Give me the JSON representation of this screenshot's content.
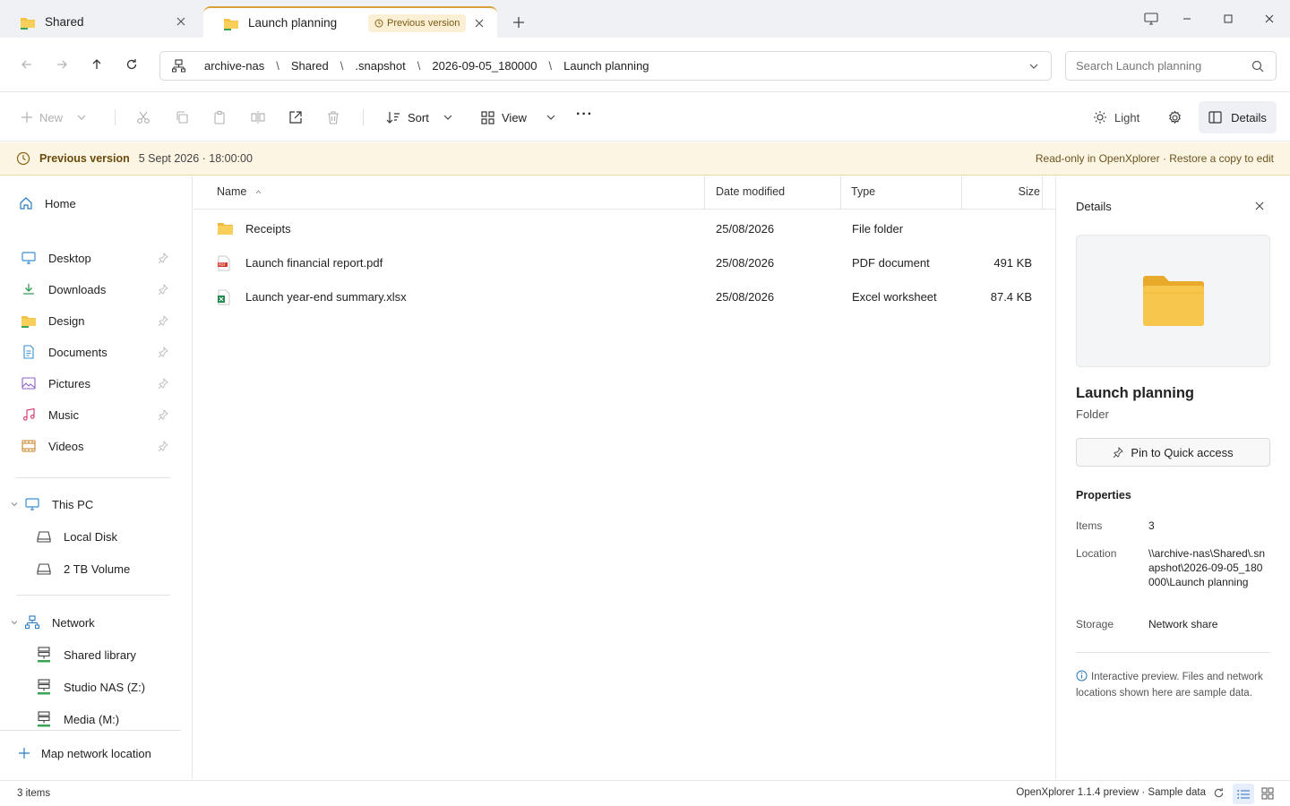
{
  "tabs": [
    {
      "label": "Shared"
    },
    {
      "label": "Launch planning",
      "badge": "Previous version"
    }
  ],
  "address": {
    "crumbs": [
      "archive-nas",
      "Shared",
      ".snapshot",
      "2026-09-05_180000",
      "Launch planning"
    ],
    "separator": "\\"
  },
  "search": {
    "placeholder": "Search Launch planning"
  },
  "toolbar": {
    "new_label": "New",
    "sort_label": "Sort",
    "view_label": "View",
    "more_label": "···",
    "theme_label": "Light",
    "details_label": "Details"
  },
  "banner": {
    "title": "Previous version",
    "date": "5 Sept 2026 · 18:00:00",
    "note": "Read-only in OpenXplorer · Restore a copy to edit"
  },
  "sidebar": {
    "home": "Home",
    "quick": [
      {
        "label": "Desktop",
        "icon": "desktop-icon"
      },
      {
        "label": "Downloads",
        "icon": "download-icon"
      },
      {
        "label": "Design",
        "icon": "folder-icon"
      },
      {
        "label": "Documents",
        "icon": "document-icon"
      },
      {
        "label": "Pictures",
        "icon": "picture-icon"
      },
      {
        "label": "Music",
        "icon": "music-icon"
      },
      {
        "label": "Videos",
        "icon": "video-icon"
      }
    ],
    "this_pc": "This PC",
    "drives": [
      "Local Disk",
      "2 TB Volume"
    ],
    "network": "Network",
    "network_items": [
      "Shared library",
      "Studio NAS (Z:)",
      "Media (M:)"
    ],
    "map_network": "Map network location"
  },
  "columns": {
    "name": "Name",
    "date": "Date modified",
    "type": "Type",
    "size": "Size"
  },
  "files": [
    {
      "name": "Receipts",
      "date": "25/08/2026",
      "type": "File folder",
      "size": "",
      "icon": "folder-icon"
    },
    {
      "name": "Launch financial report.pdf",
      "date": "25/08/2026",
      "type": "PDF document",
      "size": "491 KB",
      "icon": "pdf-icon"
    },
    {
      "name": "Launch year-end summary.xlsx",
      "date": "25/08/2026",
      "type": "Excel worksheet",
      "size": "87.4 KB",
      "icon": "excel-icon"
    }
  ],
  "details": {
    "header": "Details",
    "title": "Launch planning",
    "kind": "Folder",
    "pin_label": "Pin to Quick access",
    "properties_label": "Properties",
    "items_label": "Items",
    "items_value": "3",
    "location_label": "Location",
    "location_value": "\\\\archive-nas\\Shared\\.snapshot\\2026-09-05_180000\\Launch planning",
    "storage_label": "Storage",
    "storage_value": "Network share",
    "note": "Interactive preview. Files and network locations shown here are sample data."
  },
  "status": {
    "count": "3 items",
    "version": "OpenXplorer 1.1.4 preview · Sample data"
  },
  "colors": {
    "folder": "#f5c244",
    "accent_green": "#3aa655",
    "banner_bg": "#fcf5e3",
    "tab_accent": "#d8a23a"
  }
}
